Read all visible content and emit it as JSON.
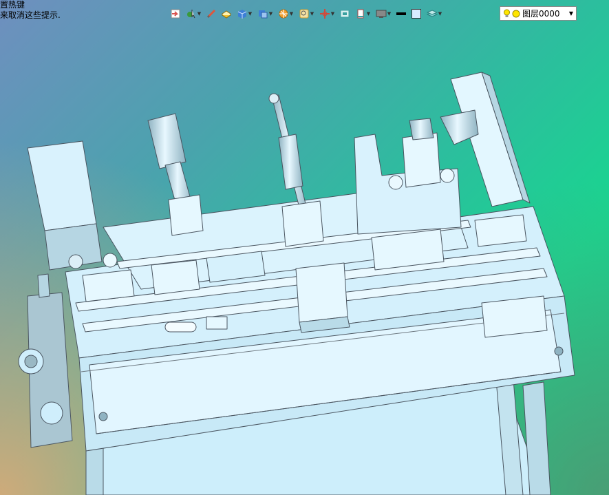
{
  "hint": {
    "line1": "置热键",
    "line2": "来取消这些提示."
  },
  "toolbar": {
    "items": [
      {
        "name": "select-icon",
        "color": "#d9534f"
      },
      {
        "name": "pick-filter-icon",
        "color": "#3a9a3a"
      },
      {
        "name": "measure-icon",
        "color": "#e0563c"
      },
      {
        "name": "render-style-icon",
        "color": "#f1c232"
      },
      {
        "name": "view-cube-icon",
        "color": "#3d7fd6"
      },
      {
        "name": "section-view-icon",
        "color": "#3d7fd6"
      },
      {
        "name": "orientation-icon",
        "color": "#f0a030"
      },
      {
        "name": "zoom-icon",
        "color": "#c99a2e"
      },
      {
        "name": "pan-icon",
        "color": "#d24a3a"
      },
      {
        "name": "fit-icon",
        "color": "#3aa0a0"
      },
      {
        "name": "clip-icon",
        "color": "#b04a4a"
      },
      {
        "name": "display-icon",
        "color": "#555555"
      },
      {
        "name": "line-style-icon",
        "color": "#000000"
      },
      {
        "name": "color-swatch-icon",
        "color": "#d9ecff"
      },
      {
        "name": "layer-manager-icon",
        "color": "#3aa0a0"
      }
    ]
  },
  "layer": {
    "current": "图层0000"
  },
  "colors": {
    "part_fill": "#cfeefc",
    "part_stroke": "#4a5560",
    "dark_part": "#aac6d2"
  }
}
